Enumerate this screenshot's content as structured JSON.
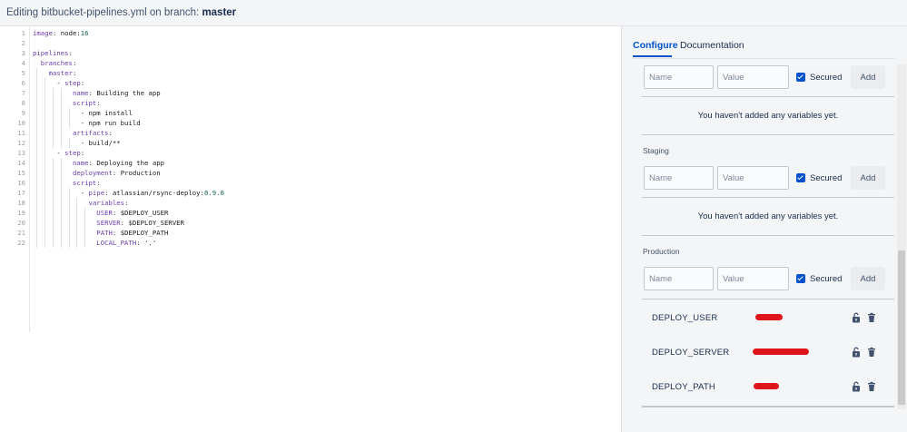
{
  "header": {
    "prefix": "Editing bitbucket-pipelines.yml on branch: ",
    "branch": "master"
  },
  "editor": {
    "lines": [
      {
        "n": "1",
        "indent": 0,
        "key": "image",
        "val": "node:",
        "num": "16"
      },
      {
        "n": "2",
        "indent": 0
      },
      {
        "n": "3",
        "indent": 0,
        "key": "pipelines"
      },
      {
        "n": "4",
        "indent": 2,
        "key": "branches"
      },
      {
        "n": "5",
        "indent": 4,
        "key": "master"
      },
      {
        "n": "6",
        "indent": 6,
        "dash": true,
        "key": "step"
      },
      {
        "n": "7",
        "indent": 10,
        "key": "name",
        "val": "Building the app"
      },
      {
        "n": "8",
        "indent": 10,
        "key": "script"
      },
      {
        "n": "9",
        "indent": 12,
        "dash": true,
        "val": "npm install"
      },
      {
        "n": "10",
        "indent": 12,
        "dash": true,
        "val": "npm run build"
      },
      {
        "n": "11",
        "indent": 10,
        "key": "artifacts"
      },
      {
        "n": "12",
        "indent": 12,
        "dash": true,
        "val": "build/**"
      },
      {
        "n": "13",
        "indent": 6,
        "dash": true,
        "key": "step"
      },
      {
        "n": "14",
        "indent": 10,
        "key": "name",
        "val": "Deploying the app"
      },
      {
        "n": "15",
        "indent": 10,
        "key": "deployment",
        "val": "Production"
      },
      {
        "n": "16",
        "indent": 10,
        "key": "script"
      },
      {
        "n": "17",
        "indent": 12,
        "dash": true,
        "key": "pipe",
        "val": "atlassian/rsync-deploy:",
        "num": "0.9.0"
      },
      {
        "n": "18",
        "indent": 14,
        "key": "variables"
      },
      {
        "n": "19",
        "indent": 16,
        "key": "USER",
        "val": "$DEPLOY_USER"
      },
      {
        "n": "20",
        "indent": 16,
        "key": "SERVER",
        "val": "$DEPLOY_SERVER"
      },
      {
        "n": "21",
        "indent": 16,
        "key": "PATH",
        "val": "$DEPLOY_PATH"
      },
      {
        "n": "22",
        "indent": 16,
        "key": "LOCAL_PATH",
        "val": "'.'"
      }
    ]
  },
  "panel": {
    "tabs": {
      "configure": "Configure",
      "documentation": "Documentation"
    },
    "name_placeholder": "Name",
    "value_placeholder": "Value",
    "secured_label": "Secured",
    "add_label": "Add",
    "empty_message": "You haven't added any variables yet.",
    "sections": {
      "staging": {
        "title": "Staging"
      },
      "production": {
        "title": "Production",
        "variables": [
          {
            "name": "DEPLOY_USER"
          },
          {
            "name": "DEPLOY_SERVER"
          },
          {
            "name": "DEPLOY_PATH"
          }
        ]
      }
    },
    "icons": {
      "lock": "unlocked-padlock-icon",
      "delete": "trash-icon"
    },
    "colors": {
      "accent": "#0052cc",
      "redaction": "#e0141b"
    }
  }
}
